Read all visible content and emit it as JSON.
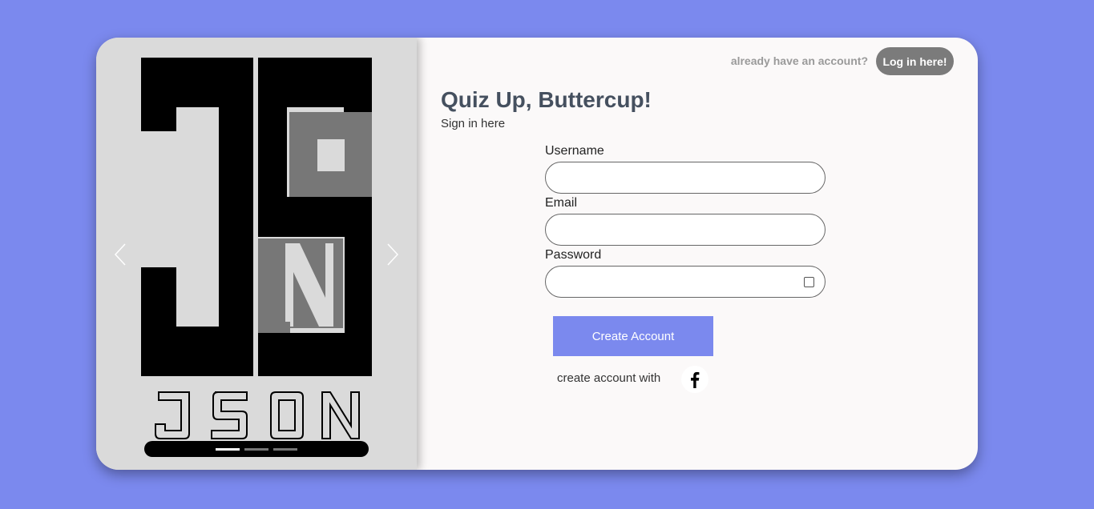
{
  "carousel": {
    "logo_text": "JSON",
    "prev_icon": "chevron-left-icon",
    "next_icon": "chevron-right-icon",
    "slide_count": 3,
    "active_slide": 1
  },
  "header": {
    "have_account_text": "already have an account?",
    "login_label": "Log in here!"
  },
  "form": {
    "title": "Quiz Up, Buttercup!",
    "subtitle": "Sign in here",
    "username_label": "Username",
    "username_value": "",
    "email_label": "Email",
    "email_value": "",
    "password_label": "Password",
    "password_value": "",
    "submit_label": "Create Account",
    "social_text": "create account with",
    "social_icon": "facebook-icon"
  },
  "colors": {
    "page_background": "#7b89ee",
    "accent": "#7b89ee",
    "login_button": "#7b7b7b",
    "title": "#45505f"
  }
}
